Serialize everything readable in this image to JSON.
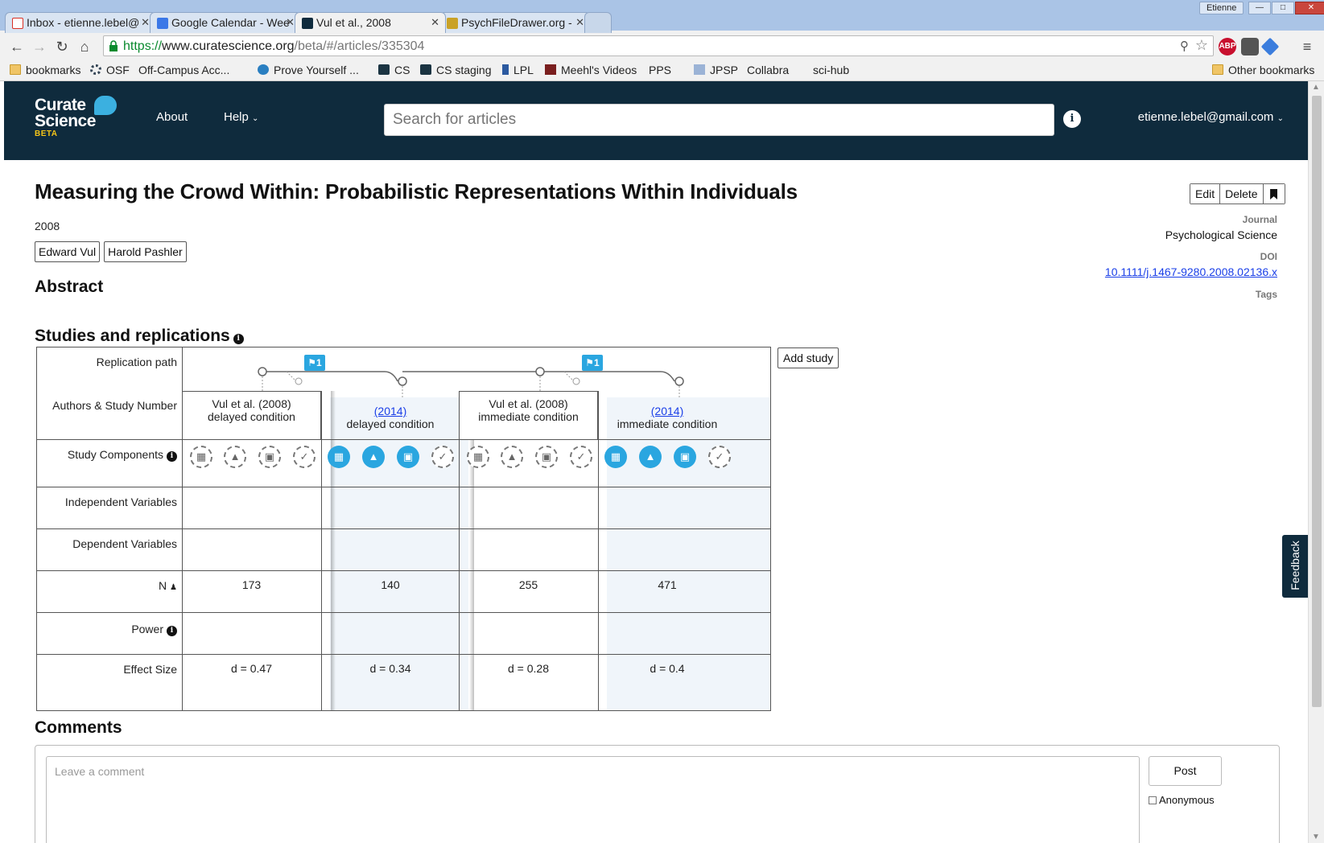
{
  "browser": {
    "profile": "Etienne",
    "tabs": [
      {
        "title": "Inbox - etienne.lebel@",
        "icon": "gmail-icon",
        "color": "#d93025"
      },
      {
        "title": "Google Calendar - Wee",
        "icon": "calendar-icon",
        "color": "#3b78e7"
      },
      {
        "title": "Vul et al., 2008",
        "icon": "curate-science-icon",
        "color": "#0f2b3d",
        "active": true
      },
      {
        "title": "PsychFileDrawer.org -",
        "icon": "psychfiledrawer-icon",
        "color": "#c9a227"
      }
    ],
    "url_scheme": "https://",
    "url_host": "www.curatescience.org",
    "url_path": "/beta/#/articles/335304",
    "bookmarks": [
      {
        "label": "bookmarks",
        "icon": "folder"
      },
      {
        "label": "OSF",
        "icon": "osf"
      },
      {
        "label": "Off-Campus Acc...",
        "icon": "page"
      },
      {
        "label": "Prove Yourself ...",
        "icon": "wp"
      },
      {
        "label": "CS",
        "icon": "cs"
      },
      {
        "label": "CS staging",
        "icon": "cs"
      },
      {
        "label": "LPL",
        "icon": "lpl"
      },
      {
        "label": "Meehl's Videos",
        "icon": "meehl"
      },
      {
        "label": "PPS",
        "icon": "page"
      },
      {
        "label": "JPSP",
        "icon": "jpsp"
      },
      {
        "label": "Collabra",
        "icon": "page"
      },
      {
        "label": "sci-hub",
        "icon": "page"
      }
    ],
    "other_bookmarks": "Other bookmarks",
    "extensions": [
      {
        "label": "ABP",
        "color": "#c8102e"
      },
      {
        "label": "",
        "color": "#555"
      },
      {
        "label": "",
        "color": "#3b7ddd"
      }
    ]
  },
  "header": {
    "logo_line1": "Curate",
    "logo_line2": "Science",
    "logo_beta": "BETA",
    "nav_about": "About",
    "nav_help": "Help",
    "search_placeholder": "Search for articles",
    "user": "etienne.lebel@gmail.com"
  },
  "article": {
    "title": "Measuring the Crowd Within: Probabilistic Representations Within Individuals",
    "year": "2008",
    "authors": [
      "Edward Vul",
      "Harold Pashler"
    ],
    "abstract_heading": "Abstract",
    "actions": {
      "edit": "Edit",
      "delete": "Delete"
    },
    "journal_label": "Journal",
    "journal": "Psychological Science",
    "doi_label": "DOI",
    "doi": "10.1111/j.1467-9280.2008.02136.x",
    "tags_label": "Tags"
  },
  "studies": {
    "heading": "Studies and replications",
    "add_study": "Add study",
    "row_labels": {
      "path": "Replication path",
      "authors": "Authors & Study Number",
      "components": "Study Components",
      "iv": "Independent Variables",
      "dv": "Dependent Variables",
      "n": "N",
      "power": "Power",
      "effect": "Effect Size"
    },
    "path_badges": [
      "1",
      "1"
    ],
    "columns": [
      {
        "link": "",
        "author": "Vul et al. (2008)",
        "condition": "delayed condition",
        "n": "173",
        "effect": "d = 0.47",
        "original": true,
        "components": [
          "off",
          "off",
          "off",
          "cert"
        ]
      },
      {
        "link": "(2014)",
        "author": "",
        "condition": "delayed condition",
        "n": "140",
        "effect": "d = 0.34",
        "original": false,
        "components": [
          "on",
          "on",
          "on",
          "cert"
        ]
      },
      {
        "link": "",
        "author": "Vul et al. (2008)",
        "condition": "immediate condition",
        "n": "255",
        "effect": "d = 0.28",
        "original": true,
        "components": [
          "off",
          "off",
          "off",
          "cert"
        ]
      },
      {
        "link": "(2014)",
        "author": "",
        "condition": "immediate condition",
        "n": "471",
        "effect": "d = 0.4",
        "original": false,
        "components": [
          "on",
          "on",
          "on",
          "cert"
        ]
      }
    ],
    "component_icons": [
      "data-icon",
      "materials-flask-icon",
      "preregistration-lock-icon",
      "badge-icon"
    ]
  },
  "feedback": "Feedback",
  "comments": {
    "heading": "Comments",
    "placeholder": "Leave a comment",
    "post": "Post",
    "anonymous": "Anonymous"
  }
}
